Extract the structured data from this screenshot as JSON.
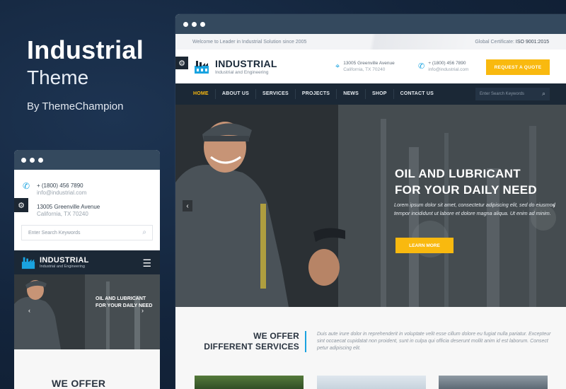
{
  "promo": {
    "title": "Industrial",
    "subtitle": "Theme",
    "byline": "By ThemeChampion"
  },
  "desktop": {
    "topbar": {
      "welcome": "Welcome to Leader in Industrial Solution since 2005",
      "certificate_label": "Global Certificate:",
      "certificate_value": "ISO 9001:2015"
    },
    "logo": {
      "name": "INDUSTRIAL",
      "tagline": "Industrial and Engineering"
    },
    "contacts": [
      {
        "icon": "map-pin-icon",
        "line1": "13005 Greenville Avenue",
        "line2": "California, TX 70240"
      },
      {
        "icon": "phone-icon",
        "line1": "+ (1800) 456 7890",
        "line2": "info@industrial.com"
      }
    ],
    "quote_button": "REQUEST A QUOTE",
    "nav": {
      "items": [
        "HOME",
        "ABOUT US",
        "SERVICES",
        "PROJECTS",
        "NEWS",
        "SHOP",
        "CONTACT US"
      ],
      "active": "HOME",
      "search_placeholder": "Enter Search Keywords"
    },
    "hero": {
      "title_line1": "OIL AND LUBRICANT",
      "title_line2": "FOR YOUR DAILY NEED",
      "body": "Lorem ipsum dolor sit amet, consectetur adipiscing elit, sed do eiusmod tempor incididunt ut labore et dolore magna aliqua. Ut enim ad minim.",
      "button": "LEARN MORE"
    },
    "offer": {
      "title_line1": "WE OFFER",
      "title_line2": "DIFFERENT SERVICES",
      "text": "Duis aute irure dolor in reprehenderit in voluptate velit esse cillum dolore eu fugiat nulla pariatur. Excepteur sint occaecat cupidatat non proident, sunt in culpa qui officia deserunt mollit anim id est laborum. Consect petur adipiscing elit."
    }
  },
  "mobile": {
    "phone": "+ (1800) 456 7890",
    "email": "info@industrial.com",
    "address_line1": "13005 Greenville Avenue",
    "address_line2": "California, TX 70240",
    "search_placeholder": "Enter Search Keywords",
    "logo": {
      "name": "INDUSTRIAL",
      "tagline": "Industrial and Engineering"
    },
    "hero": {
      "title_line1": "OIL AND LUBRICANT",
      "title_line2": "FOR YOUR DAILY NEED"
    },
    "offer_title": "WE OFFER"
  },
  "colors": {
    "accent_yellow": "#f9b90f",
    "accent_blue": "#1aa3e0",
    "nav_dark": "#1b2836",
    "chrome": "#34495e",
    "background": "#13243b"
  }
}
